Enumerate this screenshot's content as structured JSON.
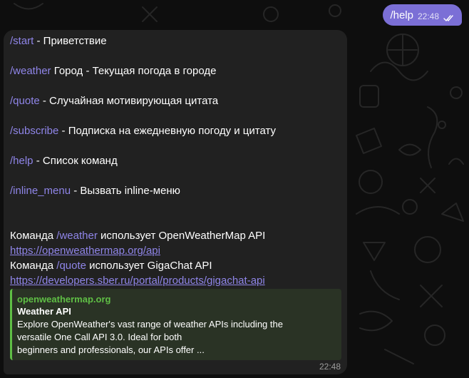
{
  "outgoing": {
    "text": "/help",
    "time": "22:48"
  },
  "incoming": {
    "commands": [
      {
        "cmd": "/start",
        "desc": " - Приветствие"
      },
      {
        "cmd": "/weather",
        "desc": " Город - Текущая погода в городе"
      },
      {
        "cmd": "/quote",
        "desc": " - Случайная мотивирующая цитата"
      },
      {
        "cmd": "/subscribe",
        "desc": " - Подписка на ежедневную погоду и цитату"
      },
      {
        "cmd": "/help",
        "desc": " - Список команд"
      },
      {
        "cmd": "/inline_menu",
        "desc": " - Вызвать inline-меню"
      }
    ],
    "info1": {
      "prefix": "Команда ",
      "cmd": "/weather",
      "suffix": " использует OpenWeatherMap API"
    },
    "link1": "https://openweathermap.org/api",
    "info2": {
      "prefix": "Команда ",
      "cmd": "/quote",
      "suffix": " использует GigaChat API"
    },
    "link2": "https://developers.sber.ru/portal/products/gigachat-api",
    "preview": {
      "site": "openweathermap.org",
      "title": "Weather API",
      "desc_lines": [
        "Explore OpenWeather's vast range of weather APIs including the",
        "versatile One Call API 3.0. Ideal for both",
        "beginners and professionals, our APIs offer ..."
      ]
    },
    "time": "22:48"
  },
  "colors": {
    "background": "#0e0e0e",
    "outgoing_bubble": "#7b6fd6",
    "incoming_bubble": "#212121",
    "command_link": "#8f85e8",
    "preview_accent": "#5fbf45",
    "preview_bg": "#2a3325"
  },
  "icons": {
    "read_status": "double-check-icon"
  }
}
